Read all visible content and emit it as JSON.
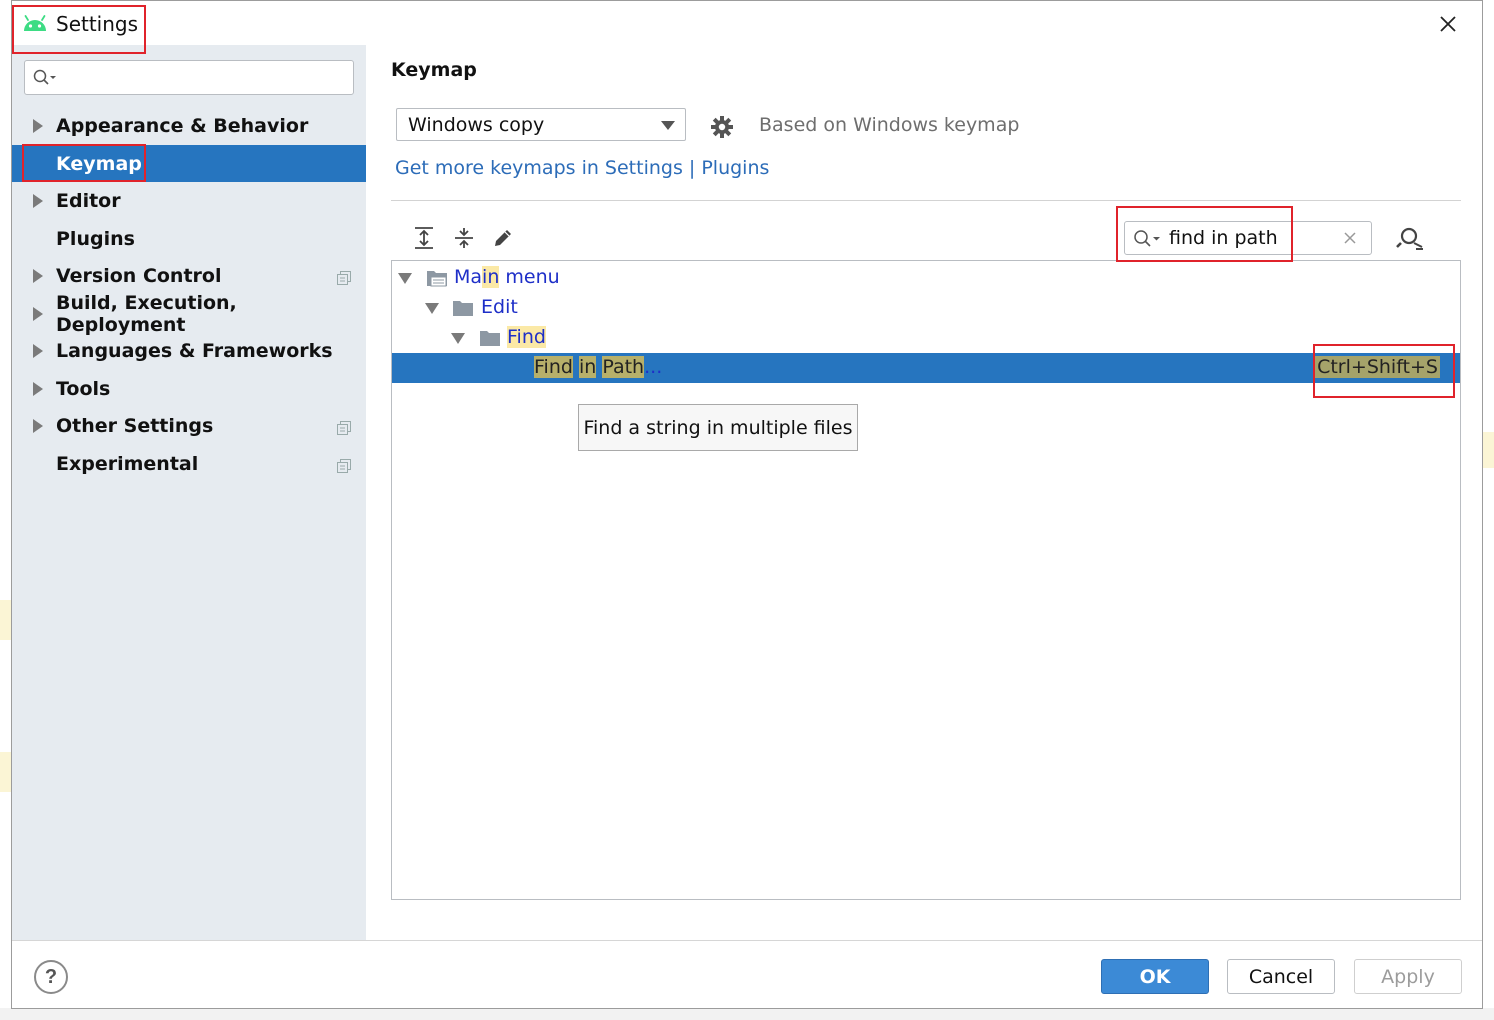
{
  "window": {
    "title": "Settings",
    "app_icon": "android-icon",
    "close_icon": "close-icon"
  },
  "sidebar": {
    "search": {
      "value": "",
      "placeholder": ""
    },
    "items": [
      {
        "label": "Appearance & Behavior",
        "expandable": true,
        "project_icon": false
      },
      {
        "label": "Keymap",
        "expandable": false,
        "selected": true,
        "project_icon": false
      },
      {
        "label": "Editor",
        "expandable": true,
        "project_icon": false
      },
      {
        "label": "Plugins",
        "expandable": false,
        "project_icon": false
      },
      {
        "label": "Version Control",
        "expandable": true,
        "project_icon": true
      },
      {
        "label": "Build, Execution, Deployment",
        "expandable": true,
        "project_icon": false
      },
      {
        "label": "Languages & Frameworks",
        "expandable": true,
        "project_icon": false
      },
      {
        "label": "Tools",
        "expandable": true,
        "project_icon": false
      },
      {
        "label": "Other Settings",
        "expandable": true,
        "project_icon": true
      },
      {
        "label": "Experimental",
        "expandable": false,
        "project_icon": true
      }
    ]
  },
  "keymap": {
    "title": "Keymap",
    "scheme": "Windows copy",
    "based_on": "Based on Windows keymap",
    "link": "Get more keymaps in Settings | Plugins",
    "toolbar": [
      "expand-all-icon",
      "collapse-all-icon",
      "edit-icon"
    ],
    "filter": {
      "value": "find in path"
    },
    "tree": {
      "main_menu": {
        "pre": "Ma",
        "hl": "in",
        "post": " menu"
      },
      "edit": "Edit",
      "find": "Find",
      "action": {
        "p1": "Find",
        "sp1": " ",
        "p2": "in",
        "sp2": " ",
        "p3": "Path",
        "suffix": "..."
      },
      "shortcut": "Ctrl+Shift+S"
    },
    "tooltip": "Find a string in multiple files"
  },
  "footer": {
    "help": "?",
    "ok": "OK",
    "cancel": "Cancel",
    "apply": "Apply"
  },
  "colors": {
    "selection": "#2675bf",
    "link": "#2c6cb8",
    "annotation": "#e0232b"
  }
}
